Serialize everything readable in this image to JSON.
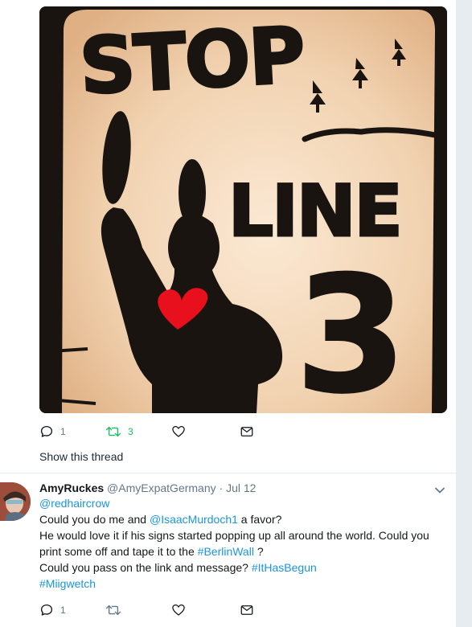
{
  "media": {
    "image_text": {
      "word1": "STOP",
      "word2": "LINE",
      "word3": "3"
    }
  },
  "thread_tweet": {
    "reply_count": "1",
    "retweet_count": "3",
    "like_count": "",
    "show_thread_label": "Show this thread"
  },
  "reply_tweet": {
    "display_name": "AmyRuckes",
    "handle": "@AmyExpatGermany",
    "separator": "·",
    "date": "Jul 12",
    "reply_to": "@redhaircrow",
    "line1_pre": "Could you do me and ",
    "line1_mention": "@IsaacMurdoch1",
    "line1_post": " a favor?",
    "line2": "He would love it if his signs started popping up all around the world. Could you",
    "line3_pre": "print some off and tape it to the ",
    "line3_tag": "#BerlinWall",
    "line3_post": " ?",
    "line4_pre": "Could you pass on the link and message? ",
    "line4_tag": "#ItHasBegun",
    "line5_tag": "#Miigwetch",
    "reply_count": "1"
  },
  "colors": {
    "link": "#1b95e0",
    "retweet": "#17bf63",
    "heart": "#e8101c",
    "icon": "#657786"
  }
}
